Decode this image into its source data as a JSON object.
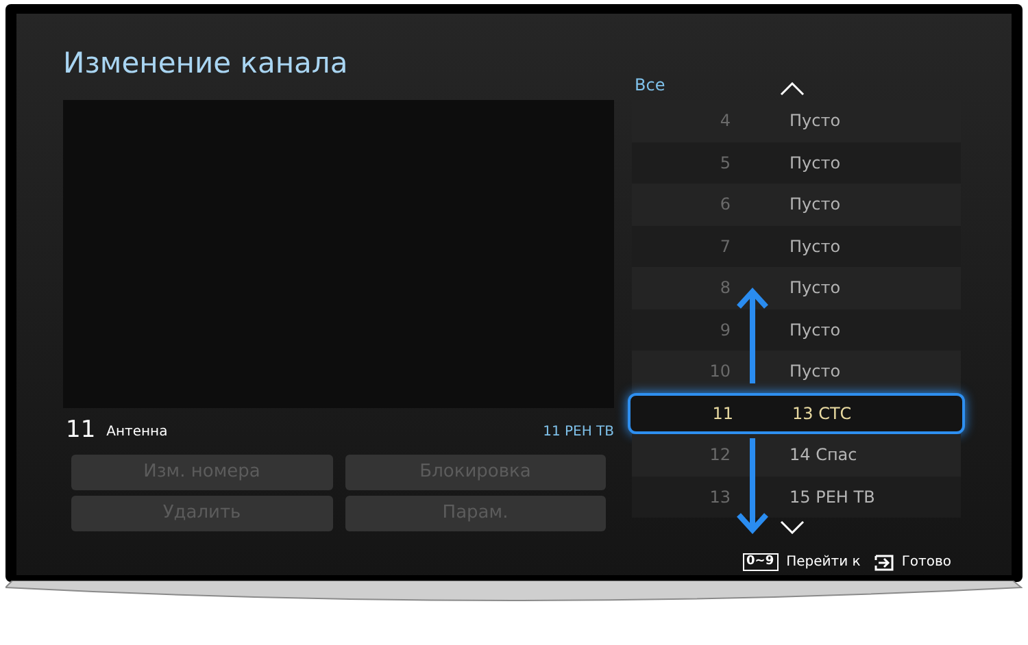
{
  "title": "Изменение канала",
  "info": {
    "number": "11",
    "source": "Антенна",
    "channel": "11 РЕН ТВ"
  },
  "buttons": [
    {
      "label": "Изм. номера",
      "disabled": true
    },
    {
      "label": "Блокировка",
      "disabled": true
    },
    {
      "label": "Удалить",
      "disabled": true
    },
    {
      "label": "Парам.",
      "disabled": true
    }
  ],
  "list": {
    "filter": "Все",
    "rows": [
      {
        "number": "4",
        "name": "Пусто",
        "selected": false
      },
      {
        "number": "5",
        "name": "Пусто",
        "selected": false
      },
      {
        "number": "6",
        "name": "Пусто",
        "selected": false
      },
      {
        "number": "7",
        "name": "Пусто",
        "selected": false
      },
      {
        "number": "8",
        "name": "Пусто",
        "selected": false
      },
      {
        "number": "9",
        "name": "Пусто",
        "selected": false
      },
      {
        "number": "10",
        "name": "Пусто",
        "selected": false
      },
      {
        "number": "11",
        "name": "13 СТС",
        "selected": true
      },
      {
        "number": "12",
        "name": "14 Спас",
        "selected": false
      },
      {
        "number": "13",
        "name": "15 РЕН ТВ",
        "selected": false
      }
    ]
  },
  "help": [
    {
      "kind": "key",
      "key": "0~9",
      "label": "Перейти к"
    },
    {
      "kind": "enter",
      "label": "Готово"
    }
  ]
}
